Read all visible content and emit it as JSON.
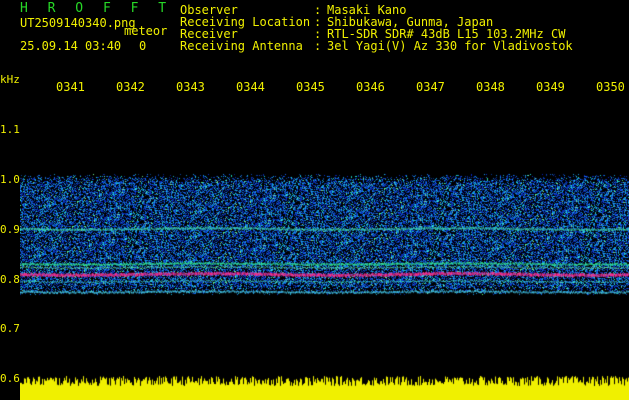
{
  "header": {
    "app_name": "H R O F F T",
    "file_name": "UT2509140340.png",
    "tag": "meteor",
    "datetime": "25.09.14 03:40",
    "count": "0",
    "info": [
      {
        "label": "Observer",
        "value": "Masaki Kano"
      },
      {
        "label": "Receiving Location",
        "value": "Shibukawa, Gunma, Japan"
      },
      {
        "label": "Receiver",
        "value": "RTL-SDR SDR# 43dB L15 103.2MHz CW"
      },
      {
        "label": "Receiving Antenna",
        "value": "3el Yagi(V) Az 330 for Vladivostok"
      }
    ]
  },
  "axes": {
    "y_unit": "kHz",
    "y_ticks": [
      "1.1",
      "1.0",
      "0.9",
      "0.8",
      "0.7",
      "0.6"
    ],
    "x_ticks": [
      "0341",
      "0342",
      "0343",
      "0344",
      "0345",
      "0346",
      "0347",
      "0348",
      "0349",
      "0350"
    ]
  },
  "colors": {
    "background": "#000000",
    "text_primary": "#f0f000",
    "title_green": "#27d827",
    "signal_strong": "#ff2060",
    "signal_mid": "#20e080",
    "noise": "#1838c8",
    "amplitude_bar": "#f0f000"
  }
}
